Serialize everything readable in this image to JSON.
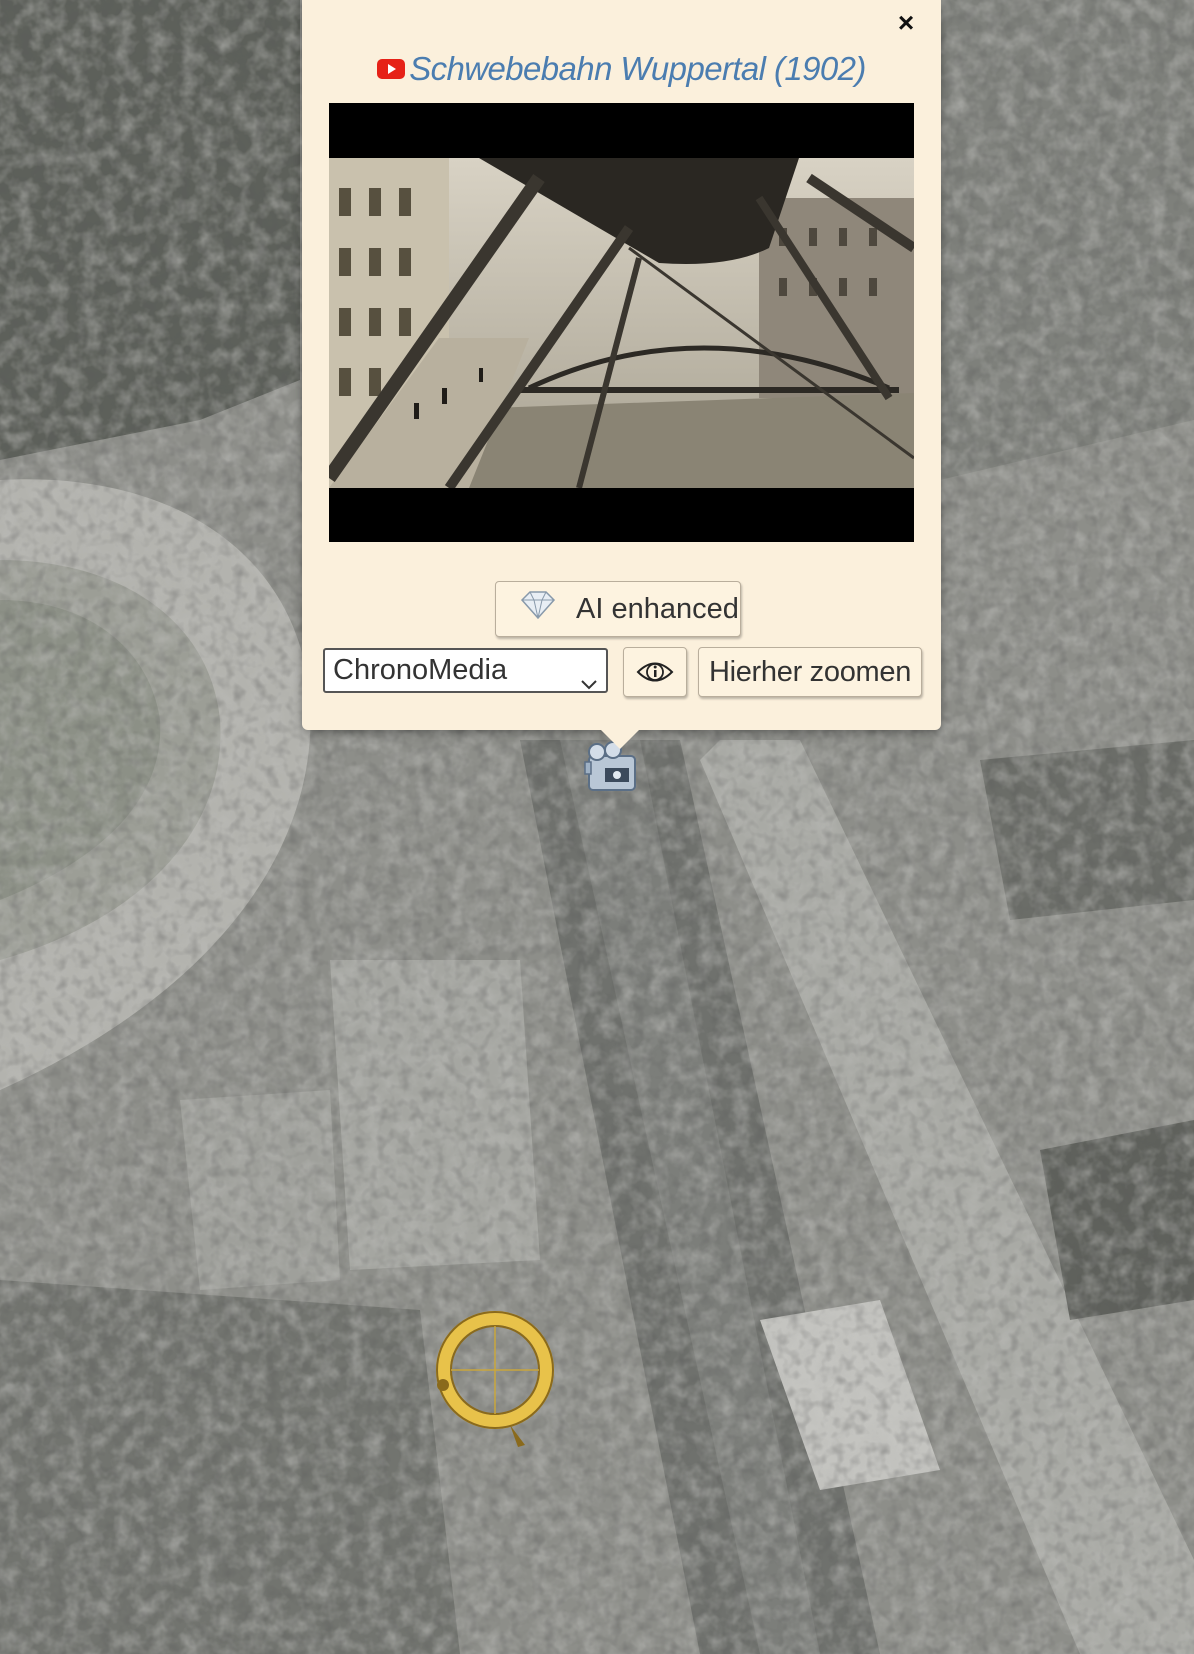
{
  "popup": {
    "title": "Schwebebahn Wuppertal (1902)",
    "close_label": "×",
    "ai_button_label": "AI enhanced",
    "source_select": {
      "selected": "ChronoMedia"
    },
    "zoom_button_label": "Hierher zoomen"
  },
  "icons": {
    "title": "youtube-icon",
    "ai": "diamond-icon",
    "info": "info-icon",
    "marker": "video-camera-icon",
    "compass": "compass-ring-icon"
  },
  "colors": {
    "popup_bg": "#fbf0dc",
    "title_link": "#4b7db0",
    "youtube_red": "#e62117",
    "compass_gold": "#e8c24a"
  }
}
